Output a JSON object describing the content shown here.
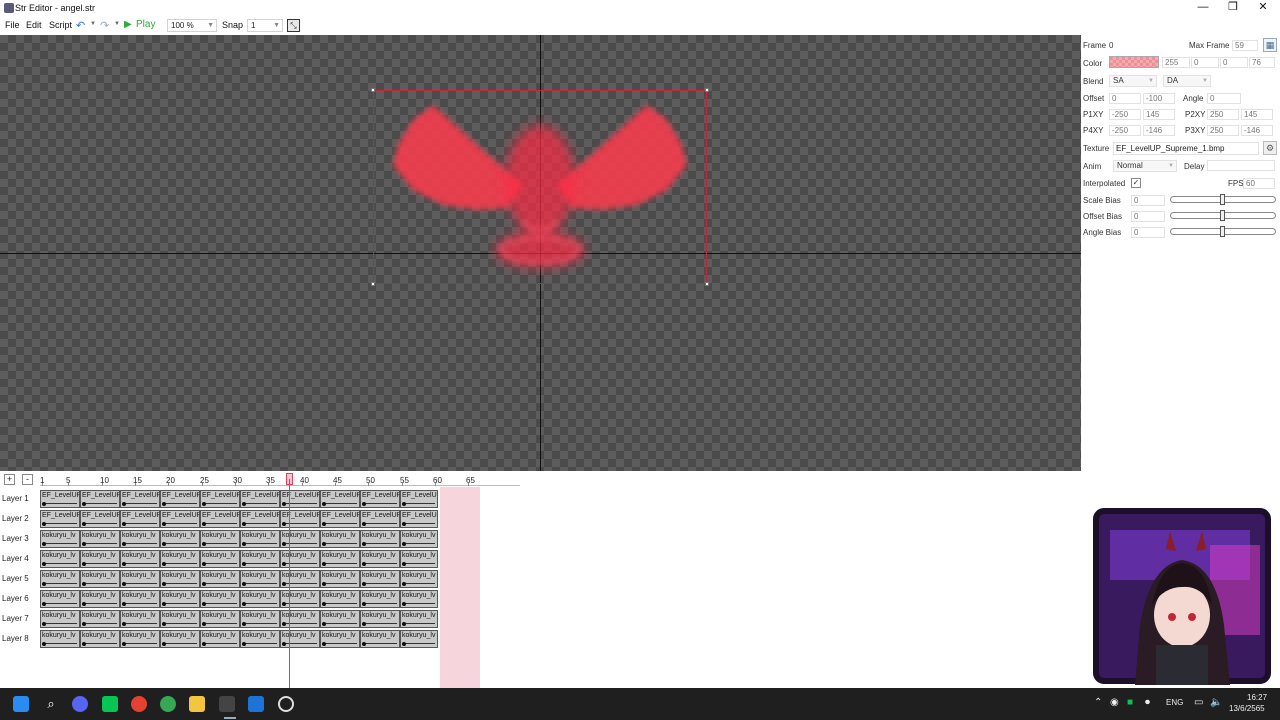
{
  "window": {
    "title": "Str Editor - angel.str",
    "minimize": "—",
    "restore": "❐",
    "close": "✕"
  },
  "toolbar": {
    "menus": [
      "File",
      "Edit",
      "Script"
    ],
    "play_label": "Play",
    "zoom_value": "100 %",
    "snap_label": "Snap",
    "snap_value": "1"
  },
  "props": {
    "frame_label": "Frame",
    "frame_value": "0",
    "max_frame_label": "Max Frame",
    "max_frame_value": "59",
    "color_label": "Color",
    "color_r": "255",
    "color_g": "0",
    "color_b": "0",
    "color_a": "76",
    "blend_label": "Blend",
    "blend_src": "SA",
    "blend_dst": "DA",
    "offset_label": "Offset",
    "offset_x": "0",
    "offset_y": "-100",
    "angle_label": "Angle",
    "angle_value": "0",
    "p1_label": "P1XY",
    "p1_x": "-250",
    "p1_y": "145",
    "p2_label": "P2XY",
    "p2_x": "250",
    "p2_y": "145",
    "p4_label": "P4XY",
    "p4_x": "-250",
    "p4_y": "-146",
    "p3_label": "P3XY",
    "p3_x": "250",
    "p3_y": "-146",
    "texture_label": "Texture",
    "texture_value": "EF_LevelUP_Supreme_1.bmp",
    "anim_label": "Anim",
    "anim_value": "Normal",
    "delay_label": "Delay",
    "delay_value": "",
    "interpolated_label": "Interpolated",
    "interpolated_check": "✓",
    "fps_label": "FPS",
    "fps_value": "60",
    "scale_bias_label": "Scale Bias",
    "scale_bias_value": "0",
    "offset_bias_label": "Offset Bias",
    "offset_bias_value": "0",
    "angle_bias_label": "Angle Bias",
    "angle_bias_value": "0"
  },
  "timeline": {
    "add_btn": "+",
    "remove_btn": "-",
    "ruler": [
      "1",
      "5",
      "10",
      "15",
      "20",
      "25",
      "30",
      "35",
      "40",
      "45",
      "50",
      "55",
      "60",
      "65"
    ],
    "layers": [
      {
        "name": "Layer 1",
        "cell": "EF_LevelUP"
      },
      {
        "name": "Layer 2",
        "cell": "EF_LevelUP"
      },
      {
        "name": "Layer 3",
        "cell": "kokuryu_lv"
      },
      {
        "name": "Layer 4",
        "cell": "kokuryu_lv"
      },
      {
        "name": "Layer 5",
        "cell": "kokuryu_lv"
      },
      {
        "name": "Layer 6",
        "cell": "kokuryu_lv"
      },
      {
        "name": "Layer 7",
        "cell": "kokuryu_lv"
      },
      {
        "name": "Layer 8",
        "cell": "kokuryu_lv"
      }
    ]
  },
  "taskbar": {
    "lang": "ENG",
    "time": "16:27",
    "date": "13/6/2565"
  },
  "colors": {
    "sprite": "#ff3b4e",
    "accent": "#e0405a",
    "play": "#2eaa3a"
  }
}
